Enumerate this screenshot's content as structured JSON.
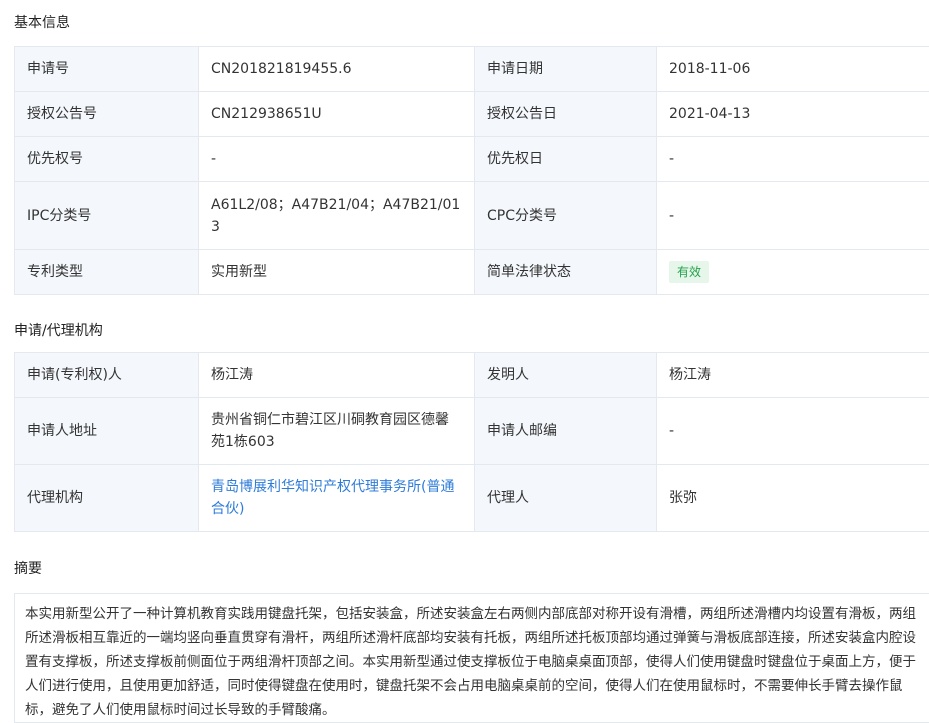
{
  "sections": {
    "basic": "基本信息",
    "agency": "申请/代理机构",
    "abstract": "摘要"
  },
  "basic_info": {
    "app_no_label": "申请号",
    "app_no": "CN201821819455.6",
    "app_date_label": "申请日期",
    "app_date": "2018-11-06",
    "grant_no_label": "授权公告号",
    "grant_no": "CN212938651U",
    "grant_date_label": "授权公告日",
    "grant_date": "2021-04-13",
    "priority_no_label": "优先权号",
    "priority_no": "-",
    "priority_date_label": "优先权日",
    "priority_date": "-",
    "ipc_label": "IPC分类号",
    "ipc": "A61L2/08；A47B21/04；A47B21/013",
    "cpc_label": "CPC分类号",
    "cpc": "-",
    "type_label": "专利类型",
    "type": "实用新型",
    "status_label": "简单法律状态",
    "status": "有效",
    "status_color": "#22a24a"
  },
  "agency_info": {
    "applicant_label": "申请(专利权)人",
    "applicant": "杨江涛",
    "inventor_label": "发明人",
    "inventor": "杨江涛",
    "address_label": "申请人地址",
    "address": "贵州省铜仁市碧江区川硐教育园区德馨苑1栋603",
    "postcode_label": "申请人邮编",
    "postcode": "-",
    "agency_label": "代理机构",
    "agency": "青岛博展利华知识产权代理事务所(普通合伙)",
    "agent_label": "代理人",
    "agent": "张弥",
    "link_color": "#2f7cd8"
  },
  "abstract": {
    "text": "本实用新型公开了一种计算机教育实践用键盘托架，包括安装盒，所述安装盒左右两侧内部底部对称开设有滑槽，两组所述滑槽内均设置有滑板，两组所述滑板相互靠近的一端均竖向垂直贯穿有滑杆，两组所述滑杆底部均安装有托板，两组所述托板顶部均通过弹簧与滑板底部连接，所述安装盒内腔设置有支撑板，所述支撑板前侧面位于两组滑杆顶部之间。本实用新型通过使支撑板位于电脑桌桌面顶部，使得人们使用键盘时键盘位于桌面上方，便于人们进行使用，且使用更加舒适，同时使得键盘在使用时，键盘托架不会占用电脑桌桌前的空间，使得人们在使用鼠标时，不需要伸长手臂去操作鼠标，避免了人们使用鼠标时间过长导致的手臂酸痛。"
  }
}
